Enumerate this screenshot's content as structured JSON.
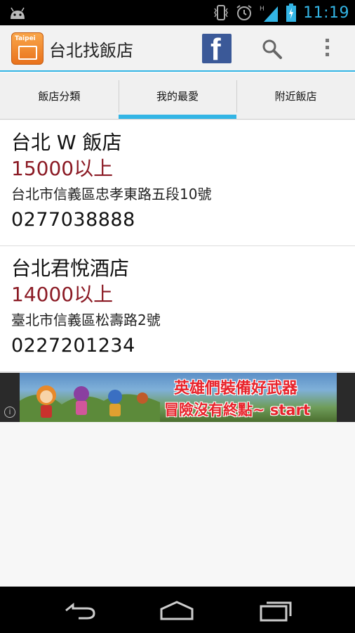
{
  "status_bar": {
    "time": "11:19",
    "icons": [
      "android-icon",
      "vibrate-icon",
      "alarm-icon",
      "signal-icon",
      "battery-charging-icon"
    ]
  },
  "action_bar": {
    "app_icon_text": "Taipei",
    "title": "台北找飯店",
    "facebook_letter": "f",
    "icons": [
      "facebook-icon",
      "search-icon",
      "overflow-menu-icon"
    ]
  },
  "tabs": [
    {
      "label": "飯店分類",
      "selected": false
    },
    {
      "label": "我的最愛",
      "selected": true
    },
    {
      "label": "附近飯店",
      "selected": false
    }
  ],
  "hotels": [
    {
      "name": "台北 W 飯店",
      "price": "15000以上",
      "address": "台北市信義區忠孝東路五段10號",
      "phone": "0277038888"
    },
    {
      "name": "台北君悅酒店",
      "price": "14000以上",
      "address": "臺北市信義區松壽路2號",
      "phone": "0227201234"
    }
  ],
  "ad": {
    "line1": "英雄們裝備好武器",
    "line2": "冒險沒有終點~ start",
    "info_symbol": "i"
  },
  "nav_bar": {
    "icons": [
      "back-icon",
      "home-icon",
      "recent-apps-icon"
    ]
  },
  "colors": {
    "accent": "#33b5e5",
    "price": "#8b1a24",
    "facebook": "#3b5998"
  }
}
